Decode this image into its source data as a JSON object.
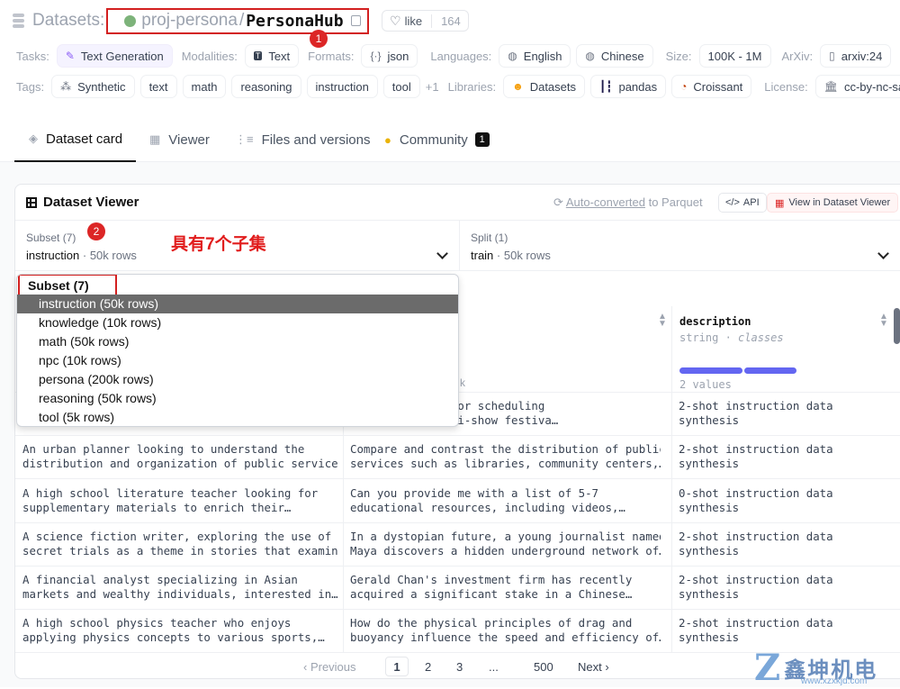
{
  "header": {
    "datasets_label": "Datasets:",
    "org": "proj-persona",
    "separator": "/",
    "repo": "PersonaHub",
    "like_label": "like",
    "like_count": "164",
    "annotation_1": "1"
  },
  "tags_row1": {
    "tasks_label": "Tasks:",
    "task": "Text Generation",
    "modalities_label": "Modalities:",
    "modality": "Text",
    "formats_label": "Formats:",
    "format": "json",
    "languages_label": "Languages:",
    "languages": [
      "English",
      "Chinese"
    ],
    "size_label": "Size:",
    "size": "100K - 1M",
    "arxiv_label": "ArXiv:",
    "arxiv": "arxiv:24"
  },
  "tags_row2": {
    "tags_label": "Tags:",
    "tags": [
      "Synthetic",
      "text",
      "math",
      "reasoning",
      "instruction",
      "tool"
    ],
    "more": "+1",
    "libraries_label": "Libraries:",
    "libraries": [
      "Datasets",
      "pandas",
      "Croissant"
    ],
    "license_label": "License:",
    "license": "cc-by-nc-sa"
  },
  "tabs": [
    {
      "label": "Dataset card",
      "active": true
    },
    {
      "label": "Viewer",
      "active": false
    },
    {
      "label": "Files and versions",
      "active": false
    },
    {
      "label": "Community",
      "active": false,
      "badge": "1"
    }
  ],
  "viewer": {
    "title": "Dataset Viewer",
    "auto_converted": "Auto-converted",
    "to_parquet": " to Parquet",
    "api_label": "API",
    "view_in_viewer": "View in Dataset Viewer",
    "subset_label": "Subset (7)",
    "subset_value": "instruction",
    "subset_rows": "· 50k rows",
    "split_label": "Split (1)",
    "split_value": "train",
    "split_rows": "· 50k rows",
    "annotation_2": "2",
    "annotation_text": "具有7个子集",
    "column_desc_name": "description",
    "column_desc_type": "string · ",
    "column_desc_type_italic": "classes",
    "column_desc_values": "2 values",
    "col2_partial": "k"
  },
  "dropdown": {
    "header": "Subset (7)",
    "items": [
      "instruction (50k rows)",
      "knowledge (10k rows)",
      "math (50k rows)",
      "npc (10k rows)",
      "persona (200k rows)",
      "reasoning (50k rows)",
      "tool (5k rows)"
    ],
    "selected_index": 0
  },
  "rows": [
    {
      "c1": "",
      "c2": "considerations for scheduling\nn hosting a multi-show festiva…",
      "c3": "2-shot instruction data\nsynthesis"
    },
    {
      "c1": "An urban planner looking to understand the\ndistribution and organization of public service…",
      "c2": "Compare and contrast the distribution of public\nservices such as libraries, community centers,…",
      "c3": "2-shot instruction data\nsynthesis"
    },
    {
      "c1": "A high school literature teacher looking for\nsupplementary materials to enrich their…",
      "c2": "Can you provide me with a list of 5-7\neducational resources, including videos,…",
      "c3": "0-shot instruction data\nsynthesis"
    },
    {
      "c1": "A science fiction writer, exploring the use of\nsecret trials as a theme in stories that examin…",
      "c2": "In a dystopian future, a young journalist named\nMaya discovers a hidden underground network of…",
      "c3": "2-shot instruction data\nsynthesis"
    },
    {
      "c1": "A financial analyst specializing in Asian\nmarkets and wealthy individuals, interested in…",
      "c2": "Gerald Chan's investment firm has recently\nacquired a significant stake in a Chinese…",
      "c3": "2-shot instruction data\nsynthesis"
    },
    {
      "c1": "A high school physics teacher who enjoys\napplying physics concepts to various sports,…",
      "c2": "How do the physical principles of drag and\nbuoyancy influence the speed and efficiency of…",
      "c3": "2-shot instruction data\nsynthesis"
    }
  ],
  "pagination": {
    "previous": "‹ Previous",
    "pages": [
      "1",
      "2",
      "3",
      "...",
      "500"
    ],
    "next": "Next ›"
  },
  "watermark": {
    "brand": "鑫坤机电",
    "url": "www.xzxkjd.com"
  },
  "colors": {
    "accent_red": "#d32020",
    "bar_purple": "#6366f1"
  }
}
